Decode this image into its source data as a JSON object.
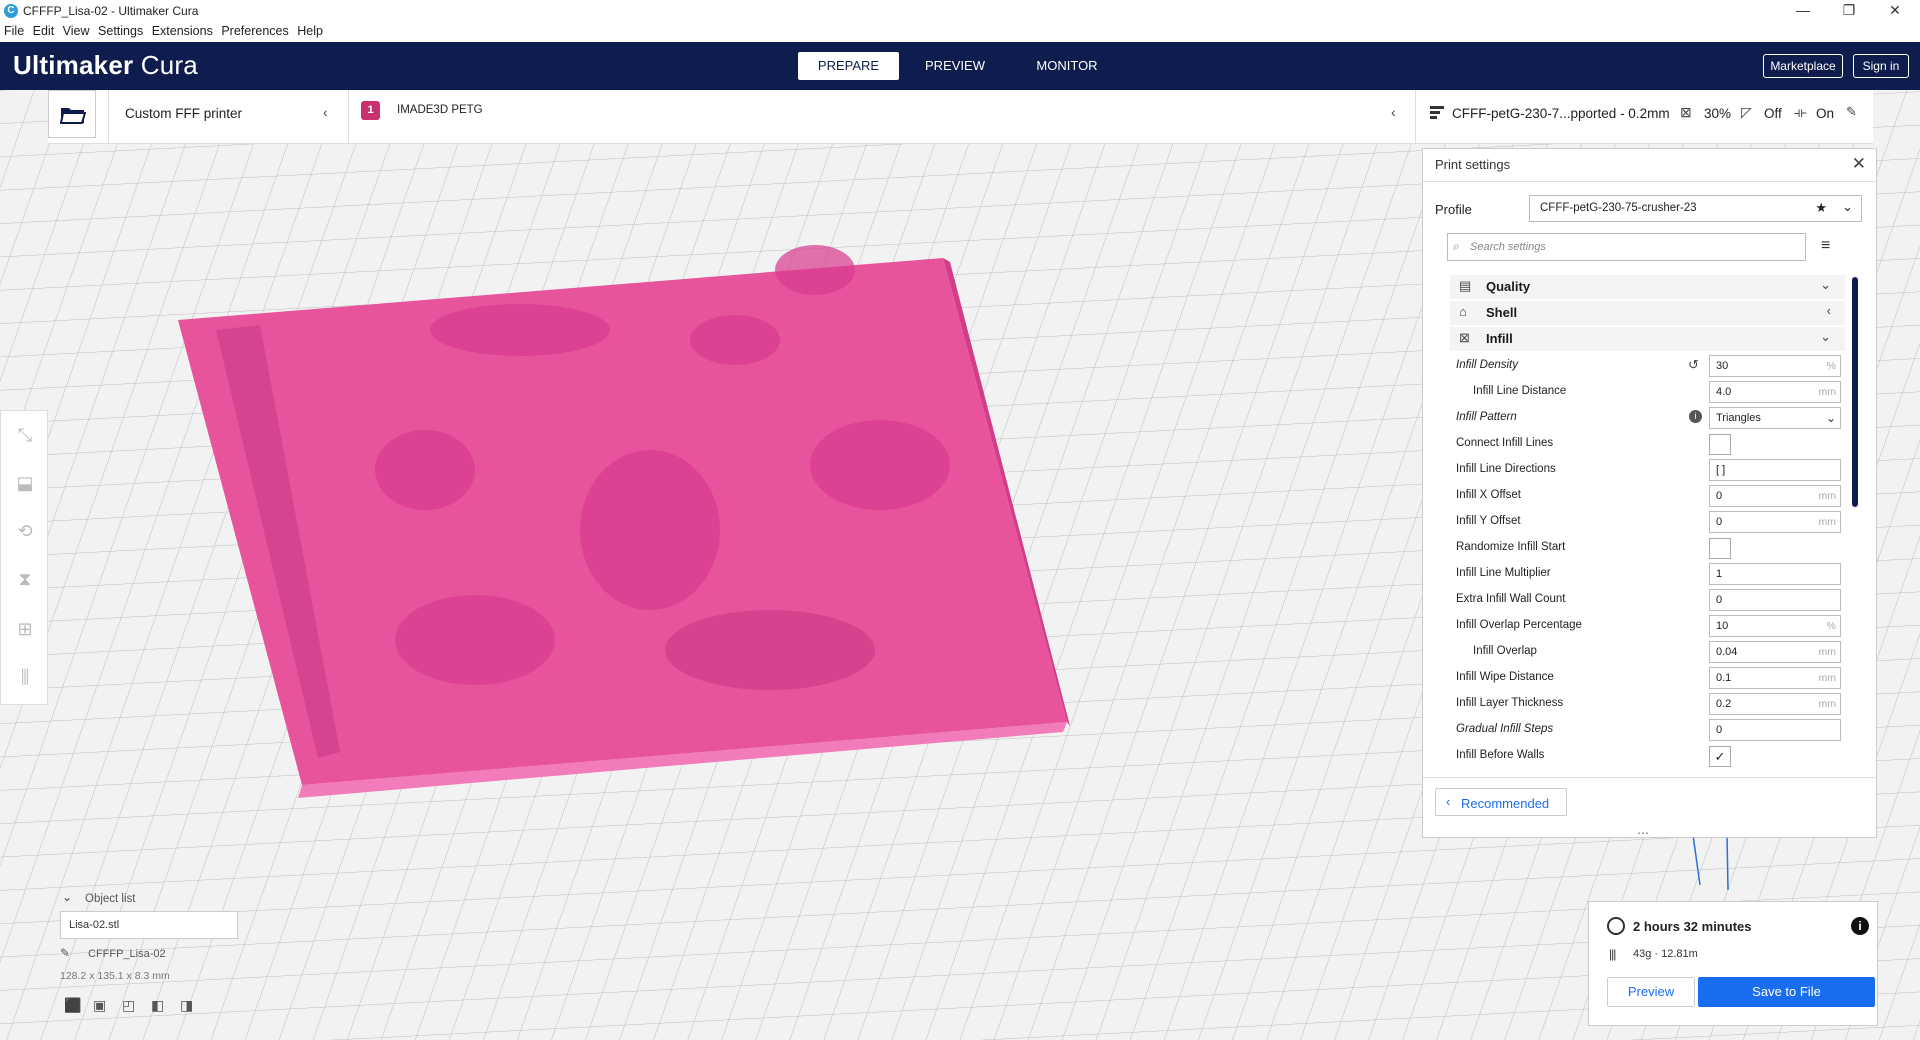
{
  "window": {
    "title": "CFFFP_Lisa-02 - Ultimaker Cura"
  },
  "menu": [
    "File",
    "Edit",
    "View",
    "Settings",
    "Extensions",
    "Preferences",
    "Help"
  ],
  "header": {
    "brand": "Ultimaker",
    "product": "Cura",
    "tabs": [
      "PREPARE",
      "PREVIEW",
      "MONITOR"
    ],
    "marketplace": "Marketplace",
    "signin": "Sign in"
  },
  "stagebar": {
    "printer": "Custom FFF printer",
    "material": "IMADE3D PETG",
    "profile_summary": "CFFF-petG-230-7...pported - 0.2mm",
    "infill": "30%",
    "support": "Off",
    "adhesion": "On"
  },
  "print_settings": {
    "title": "Print settings",
    "profile_label": "Profile",
    "profile": "CFFF-petG-230-75-crusher-23",
    "search_placeholder": "Search settings",
    "categories": [
      {
        "label": "Quality"
      },
      {
        "label": "Shell"
      },
      {
        "label": "Infill"
      }
    ],
    "rows": [
      {
        "label": "Infill Density",
        "value": "30",
        "unit": "%"
      },
      {
        "label": "Infill Line Distance",
        "value": "4.0",
        "unit": "mm"
      },
      {
        "label": "Infill Pattern",
        "value": "Triangles",
        "unit": ""
      },
      {
        "label": "Connect Infill Lines",
        "value": "",
        "unit": ""
      },
      {
        "label": "Infill Line Directions",
        "value": "[ ]",
        "unit": ""
      },
      {
        "label": "Infill X Offset",
        "value": "0",
        "unit": "mm"
      },
      {
        "label": "Infill Y Offset",
        "value": "0",
        "unit": "mm"
      },
      {
        "label": "Randomize Infill Start",
        "value": "",
        "unit": ""
      },
      {
        "label": "Infill Line Multiplier",
        "value": "1",
        "unit": ""
      },
      {
        "label": "Extra Infill Wall Count",
        "value": "0",
        "unit": ""
      },
      {
        "label": "Infill Overlap Percentage",
        "value": "10",
        "unit": "%"
      },
      {
        "label": "Infill Overlap",
        "value": "0.04",
        "unit": "mm"
      },
      {
        "label": "Infill Wipe Distance",
        "value": "0.1",
        "unit": "mm"
      },
      {
        "label": "Infill Layer Thickness",
        "value": "0.2",
        "unit": "mm"
      },
      {
        "label": "Gradual Infill Steps",
        "value": "0",
        "unit": ""
      },
      {
        "label": "Infill Before Walls",
        "value": "✓",
        "unit": ""
      }
    ],
    "recommended": "Recommended"
  },
  "objects": {
    "title": "Object list",
    "file": "Lisa-02.stl",
    "name": "CFFFP_Lisa-02",
    "dims": "128.2 x 135.1 x 8.3 mm"
  },
  "job": {
    "time": "2 hours 32 minutes",
    "material": "43g · 12.81m",
    "preview": "Preview",
    "save": "Save to File"
  },
  "colors": {
    "accent": "#196ef0",
    "header": "#0f1d4e",
    "model": "#e8549c"
  }
}
